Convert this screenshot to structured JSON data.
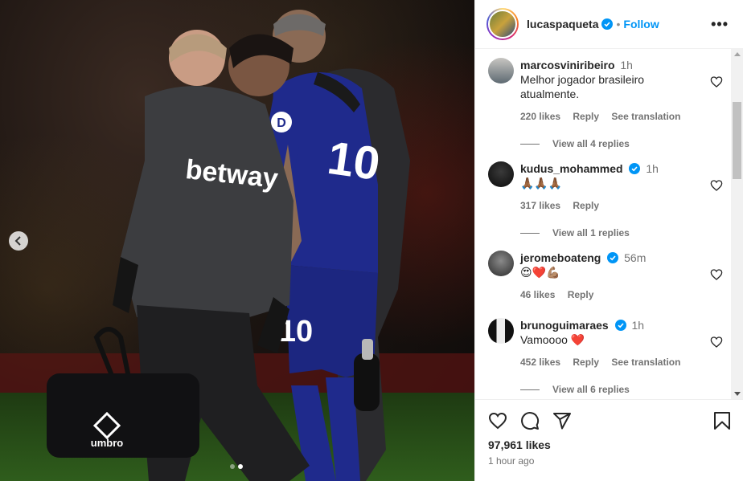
{
  "post": {
    "username": "lucaspaqueta",
    "follow_label": "Follow",
    "separator": "•",
    "more_label": "•••",
    "likes": "97,961 likes",
    "posted": "1 hour ago",
    "carousel": {
      "count": 2,
      "active_index": 1
    }
  },
  "photo": {
    "jersey_number": "10",
    "shorts_number": "10",
    "sponsor": "betway",
    "bag_brand": "umbro",
    "sleeve_logo": "D"
  },
  "comments": [
    {
      "user": "marcosviniribeiro",
      "verified": false,
      "time": "1h",
      "text": "Melhor jogador brasileiro atualmente.",
      "likes": "220 likes",
      "reply": "Reply",
      "translation": "See translation",
      "view_replies": "View all 4 replies"
    },
    {
      "user": "kudus_mohammed",
      "verified": true,
      "time": "1h",
      "text": "🙏🏾🙏🏾🙏🏾",
      "likes": "317 likes",
      "reply": "Reply",
      "translation": "",
      "view_replies": "View all 1 replies"
    },
    {
      "user": "jeromeboateng",
      "verified": true,
      "time": "56m",
      "text": "😍❤️💪🏽",
      "likes": "46 likes",
      "reply": "Reply",
      "translation": "",
      "view_replies": ""
    },
    {
      "user": "brunoguimaraes",
      "verified": true,
      "time": "1h",
      "text": "Vamoooo ❤️",
      "likes": "452 likes",
      "reply": "Reply",
      "translation": "See translation",
      "view_replies": "View all 6 replies"
    }
  ],
  "icons": {
    "verified": "verified-badge-icon",
    "like": "heart-icon",
    "comment": "comment-icon",
    "share": "paper-plane-icon",
    "save": "bookmark-icon",
    "prev": "chevron-left-icon"
  },
  "colors": {
    "link": "#0095f6",
    "verified": "#0095f6",
    "muted": "#737373",
    "jersey": "#1f2a8c"
  }
}
